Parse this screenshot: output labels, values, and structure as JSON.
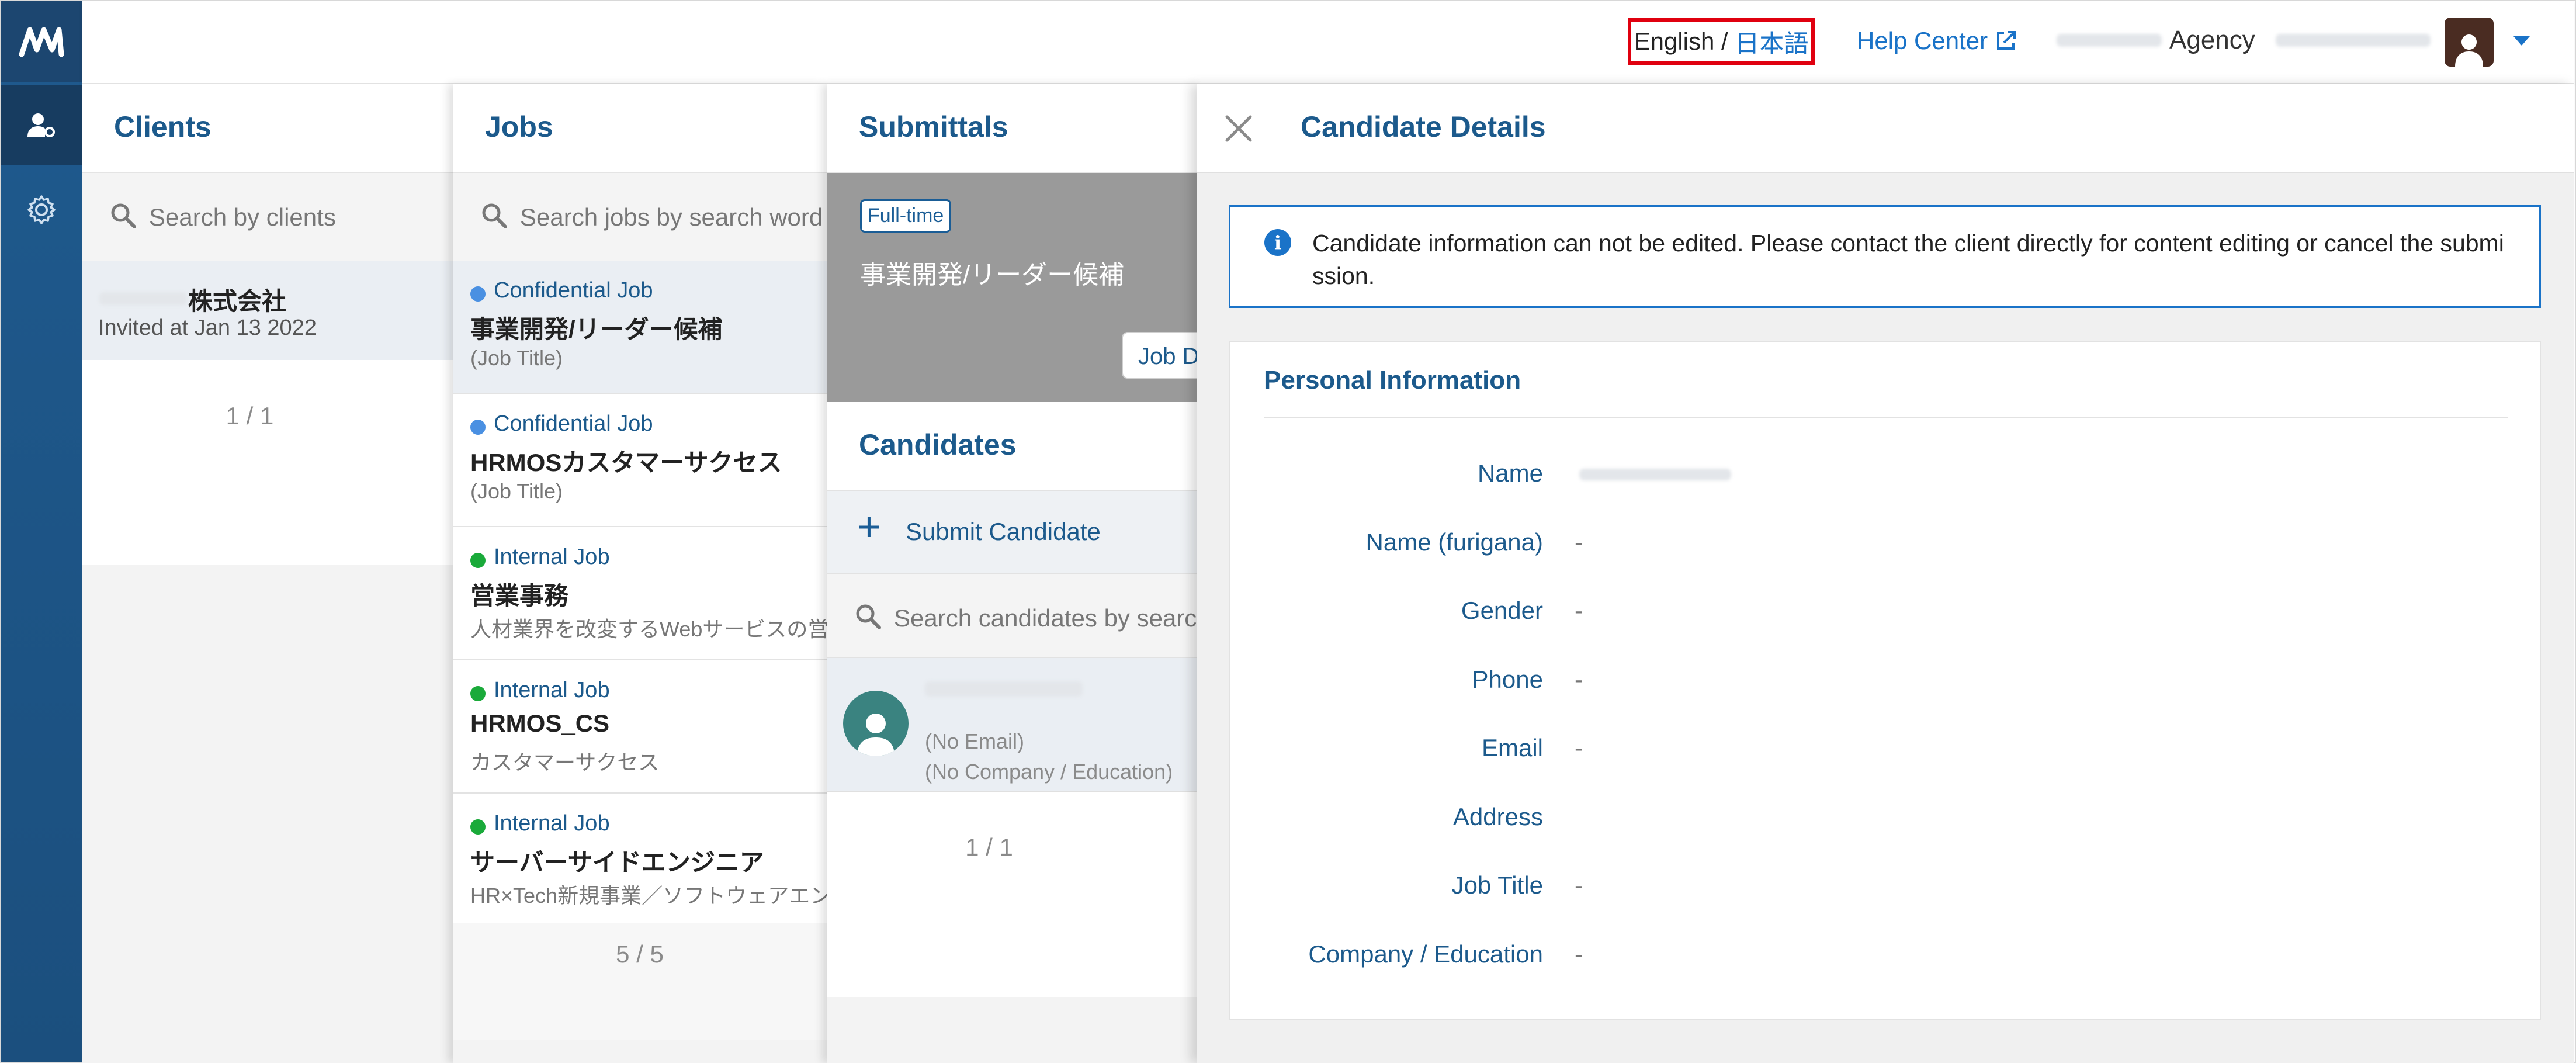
{
  "header": {
    "lang_en": "English",
    "lang_sep": "/",
    "lang_jp": "日本語",
    "help": "Help Center",
    "agency": "Agency"
  },
  "clients": {
    "title": "Clients",
    "search_placeholder": "Search by clients",
    "row": {
      "name": "株式会社",
      "sub": "Invited at Jan 13 2022"
    },
    "pager": "1 / 1"
  },
  "jobs": {
    "title": "Jobs",
    "search_placeholder": "Search jobs by search word",
    "items": [
      {
        "type": "Confidential Job",
        "title": "事業開発/リーダー候補",
        "sub": "(Job Title)",
        "color": "#4a90e2"
      },
      {
        "type": "Confidential Job",
        "title": "HRMOSカスタマーサクセス",
        "sub": "(Job Title)",
        "color": "#4a90e2"
      },
      {
        "type": "Internal Job",
        "title": "営業事務",
        "sub": "人材業界を改変するWebサービスの営業事務",
        "color": "#1aaa3a"
      },
      {
        "type": "Internal Job",
        "title": "HRMOS_CS",
        "sub": "カスタマーサクセス",
        "color": "#1aaa3a"
      },
      {
        "type": "Internal Job",
        "title": "サーバーサイドエンジニア",
        "sub": "HR×Tech新規事業／ソフトウェアエンジニア",
        "color": "#1aaa3a"
      }
    ],
    "pager": "5 / 5"
  },
  "submittals": {
    "title": "Submittals",
    "badge": "Full-time",
    "job_title": "事業開発/リーダー候補",
    "job_detail_btn": "Job Details",
    "candidates_title": "Candidates",
    "submit_label": "Submit Candidate",
    "search_placeholder": "Search candidates by search word",
    "candidate": {
      "email": "(No Email)",
      "company": "(No Company / Education)"
    },
    "pager": "1 / 1"
  },
  "detail": {
    "title": "Candidate Details",
    "notice": "Candidate information can not be edited. Please contact the client directly for content editing or cancel the submission.",
    "section": "Personal Information",
    "fields": [
      {
        "label": "Name",
        "value": ""
      },
      {
        "label": "Name (furigana)",
        "value": "-"
      },
      {
        "label": "Gender",
        "value": "-"
      },
      {
        "label": "Phone",
        "value": "-"
      },
      {
        "label": "Email",
        "value": "-"
      },
      {
        "label": "Address",
        "value": ""
      },
      {
        "label": "Job Title",
        "value": "-"
      },
      {
        "label": "Company / Education",
        "value": "-"
      }
    ]
  },
  "colors": {
    "brand": "#1c5a8c",
    "link": "#1a73c8",
    "highlight": "#e0000f"
  },
  "icons": [
    "logo-icon",
    "user-settings-icon",
    "gear-icon",
    "external-link-icon",
    "avatar-icon",
    "search-icon",
    "plus-icon",
    "close-icon",
    "info-icon"
  ]
}
